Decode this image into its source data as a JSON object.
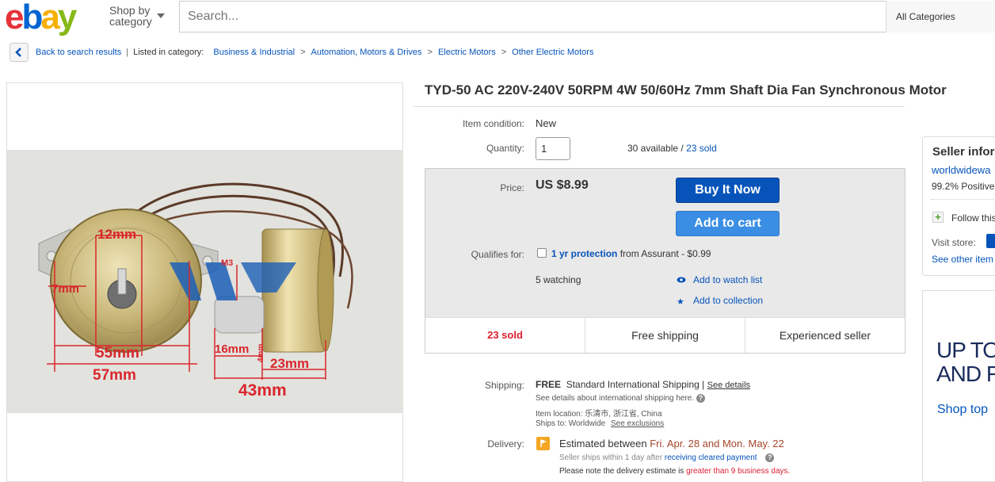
{
  "header": {
    "logo_letters": [
      "e",
      "b",
      "a",
      "y"
    ],
    "logo_colors": [
      "#e53238",
      "#0064d2",
      "#f5af02",
      "#86b817"
    ],
    "shop_by_line1": "Shop by",
    "shop_by_line2": "category",
    "search_placeholder": "Search...",
    "category_select": "All Categories"
  },
  "breadcrumb": {
    "back_label": "Back to search results",
    "listed_label": "Listed in category:",
    "path": [
      "Business & Industrial",
      "Automation, Motors & Drives",
      "Electric Motors",
      "Other Electric Motors"
    ]
  },
  "photo": {
    "dim_12": "12mm",
    "dim_7": "7mm",
    "dim_55": "55mm",
    "dim_57": "57mm",
    "dim_16": "16mm",
    "dim_4": "4mm",
    "dim_23": "23mm",
    "dim_43": "43mm",
    "m3": "M3"
  },
  "item": {
    "title": "TYD-50 AC 220V-240V 50RPM 4W 50/60Hz 7mm Shaft Dia Fan Synchronous Motor",
    "condition_label": "Item condition:",
    "condition": "New",
    "quantity_label": "Quantity:",
    "quantity": "1",
    "available": "30 available /",
    "sold_link": "23 sold"
  },
  "purchase": {
    "price_label": "Price:",
    "price": "US $8.99",
    "buy_now": "Buy It Now",
    "add_to_cart": "Add to cart",
    "qualifies_label": "Qualifies for:",
    "protection_link": "1 yr protection",
    "protection_rest": "from Assurant - $0.99",
    "watching": "5 watching",
    "watch_link": "Add to watch list",
    "collection_link": "Add to collection",
    "stats": [
      "23 sold",
      "Free shipping",
      "Experienced seller"
    ]
  },
  "shipping": {
    "label": "Shipping:",
    "free": "FREE",
    "method": "Standard International Shipping |",
    "details_link": "See details",
    "intl_note": "See details about international shipping here.",
    "location_label": "Item location:",
    "location": "乐清市, 浙江省, China",
    "ships_to_label": "Ships to:",
    "ships_to": "Worldwide",
    "exclusions_link": "See exclusions"
  },
  "delivery": {
    "label": "Delivery:",
    "estimated": "Estimated between",
    "dates": "Fri. Apr. 28 and Mon. May. 22",
    "seller_ships": "Seller ships within 1 day after",
    "payment_link": "receiving cleared payment",
    "note": "Please note the delivery estimate is",
    "note_highlight": "greater than 9 business days."
  },
  "seller": {
    "heading": "Seller infor",
    "name": "worldwidewa",
    "feedback": "99.2% Positive",
    "follow": "Follow this",
    "visit_store": "Visit store:",
    "other_items": "See other item"
  },
  "ad": {
    "line1": "UP TO",
    "line2": "AND F",
    "shop": "Shop top"
  }
}
